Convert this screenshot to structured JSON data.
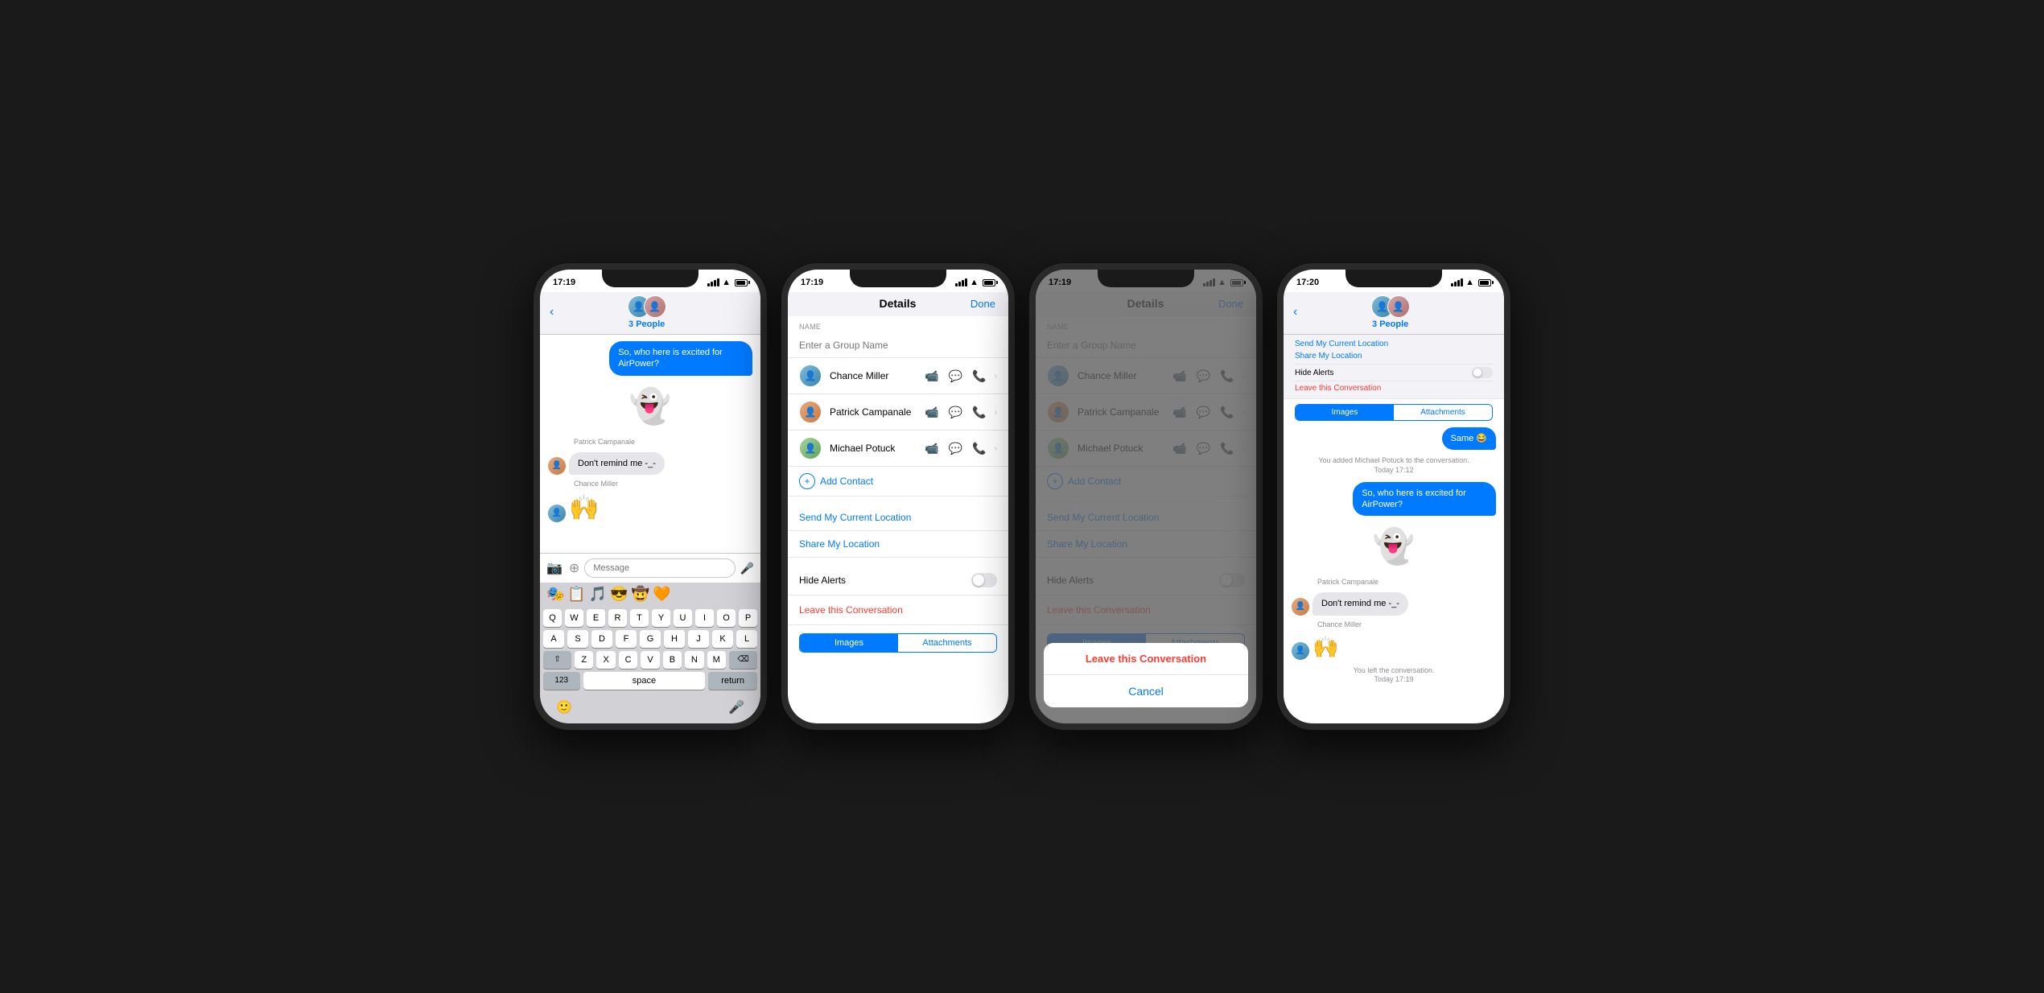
{
  "phones": [
    {
      "id": "phone1",
      "time": "17:19",
      "type": "messages",
      "group_name": "3 People",
      "messages": [
        {
          "type": "outgoing",
          "text": "So, who here is excited for AirPower?"
        },
        {
          "type": "ghost_emoji"
        },
        {
          "type": "sender_label",
          "name": "Patrick Campanale"
        },
        {
          "type": "incoming",
          "text": "Don't remind me -_-",
          "avatar": true
        },
        {
          "type": "sender_label",
          "name": "Chance Miller"
        },
        {
          "type": "hands_emoji",
          "avatar": true
        }
      ],
      "input_placeholder": "Message",
      "emoji_row": [
        "🎭",
        "📋",
        "🎵",
        "😎",
        "🤠",
        "🧡"
      ],
      "keyboard_rows": [
        [
          "Q",
          "W",
          "E",
          "R",
          "T",
          "Y",
          "U",
          "I",
          "O",
          "P"
        ],
        [
          "A",
          "S",
          "D",
          "F",
          "G",
          "H",
          "J",
          "K",
          "L"
        ],
        [
          "⇧",
          "Z",
          "X",
          "C",
          "V",
          "B",
          "N",
          "M",
          "⌫"
        ],
        [
          "123",
          "space",
          "return"
        ]
      ]
    },
    {
      "id": "phone2",
      "time": "17:19",
      "type": "details",
      "title": "Details",
      "done_label": "Done",
      "section_name": "NAME",
      "name_placeholder": "Enter a Group Name",
      "contacts": [
        {
          "name": "Chance Miller"
        },
        {
          "name": "Patrick Campanale"
        },
        {
          "name": "Michael Potuck"
        }
      ],
      "add_contact_label": "Add Contact",
      "send_location": "Send My Current Location",
      "share_location": "Share My Location",
      "hide_alerts": "Hide Alerts",
      "leave_conversation": "Leave this Conversation",
      "segments": [
        "Images",
        "Attachments"
      ]
    },
    {
      "id": "phone3",
      "time": "17:19",
      "type": "details_overlay",
      "title": "Details",
      "done_label": "Done",
      "section_name": "NAME",
      "name_placeholder": "Enter a Group Name",
      "contacts": [
        {
          "name": "Chance Miller"
        },
        {
          "name": "Patrick Campanale"
        },
        {
          "name": "Michael Potuck"
        }
      ],
      "add_contact_label": "Add Contact",
      "send_location": "Send My Current Location",
      "share_location": "Share My Location",
      "hide_alerts": "Hide Alerts",
      "leave_conversation": "Leave this Conversation",
      "segments": [
        "Images",
        "Attachments"
      ],
      "action_sheet": {
        "confirm_label": "Leave this Conversation",
        "cancel_label": "Cancel"
      }
    },
    {
      "id": "phone4",
      "time": "17:20",
      "type": "messages_result",
      "group_name": "3 People",
      "messages": [
        {
          "type": "location_link",
          "text": "Send My Current Location"
        },
        {
          "type": "location_link2",
          "text": "Share My Location"
        },
        {
          "type": "toggle_row",
          "label": "Hide Alerts"
        },
        {
          "type": "leave_static",
          "label": "Leave this Conversation"
        },
        {
          "type": "outgoing",
          "text": "Same 😂"
        },
        {
          "type": "system",
          "text": "You added Michael Potuck to the conversation.\nToday 17:12"
        },
        {
          "type": "outgoing_bubble",
          "text": "So, who here is excited for AirPower?"
        },
        {
          "type": "ghost_emoji"
        },
        {
          "type": "sender_label",
          "name": "Patrick Campanale"
        },
        {
          "type": "incoming_msg",
          "text": "Don't remind me -_-"
        },
        {
          "type": "sender_label2",
          "name": "Chance Miller"
        },
        {
          "type": "hands_emoji2"
        },
        {
          "type": "system2",
          "text": "You left the conversation.\nToday 17:19"
        }
      ]
    }
  ],
  "colors": {
    "ios_blue": "#007aff",
    "ios_red": "#ff3b30",
    "bubble_out": "#007aff",
    "bubble_in": "#e5e5ea",
    "bg": "#f2f2f7"
  }
}
